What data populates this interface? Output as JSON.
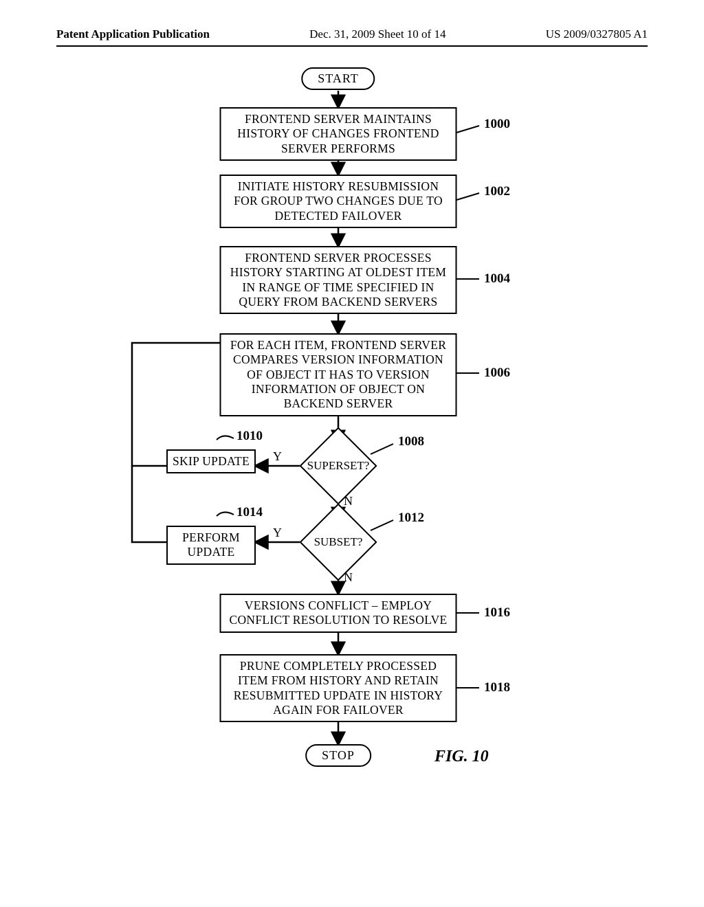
{
  "header": {
    "left": "Patent Application Publication",
    "mid": "Dec. 31, 2009  Sheet 10 of 14",
    "right": "US 2009/0327805 A1"
  },
  "nodes": {
    "start": "START",
    "b1000": "FRONTEND SERVER MAINTAINS HISTORY OF CHANGES FRONTEND SERVER PERFORMS",
    "b1002": "INITIATE HISTORY RESUBMISSION FOR GROUP TWO CHANGES DUE TO DETECTED FAILOVER",
    "b1004": "FRONTEND SERVER PROCESSES HISTORY STARTING AT OLDEST ITEM IN RANGE OF TIME SPECIFIED IN QUERY FROM BACKEND SERVERS",
    "b1006": "FOR EACH ITEM, FRONTEND SERVER COMPARES VERSION INFORMATION OF OBJECT IT HAS TO VERSION INFORMATION OF OBJECT ON BACKEND SERVER",
    "d1008": "SUPERSET?",
    "b1010": "SKIP UPDATE",
    "d1012": "SUBSET?",
    "b1014": "PERFORM UPDATE",
    "b1016": "VERSIONS CONFLICT – EMPLOY CONFLICT RESOLUTION TO RESOLVE",
    "b1018": "PRUNE COMPLETELY PROCESSED ITEM FROM HISTORY AND RETAIN RESUBMITTED UPDATE IN HISTORY AGAIN FOR FAILOVER",
    "stop": "STOP"
  },
  "labels": {
    "ref1000": "1000",
    "ref1002": "1002",
    "ref1004": "1004",
    "ref1006": "1006",
    "ref1008": "1008",
    "ref1010": "1010",
    "ref1012": "1012",
    "ref1014": "1014",
    "ref1016": "1016",
    "ref1018": "1018",
    "y1": "Y",
    "n1": "N",
    "y2": "Y",
    "n2": "N"
  },
  "figure": "FIG. 10"
}
